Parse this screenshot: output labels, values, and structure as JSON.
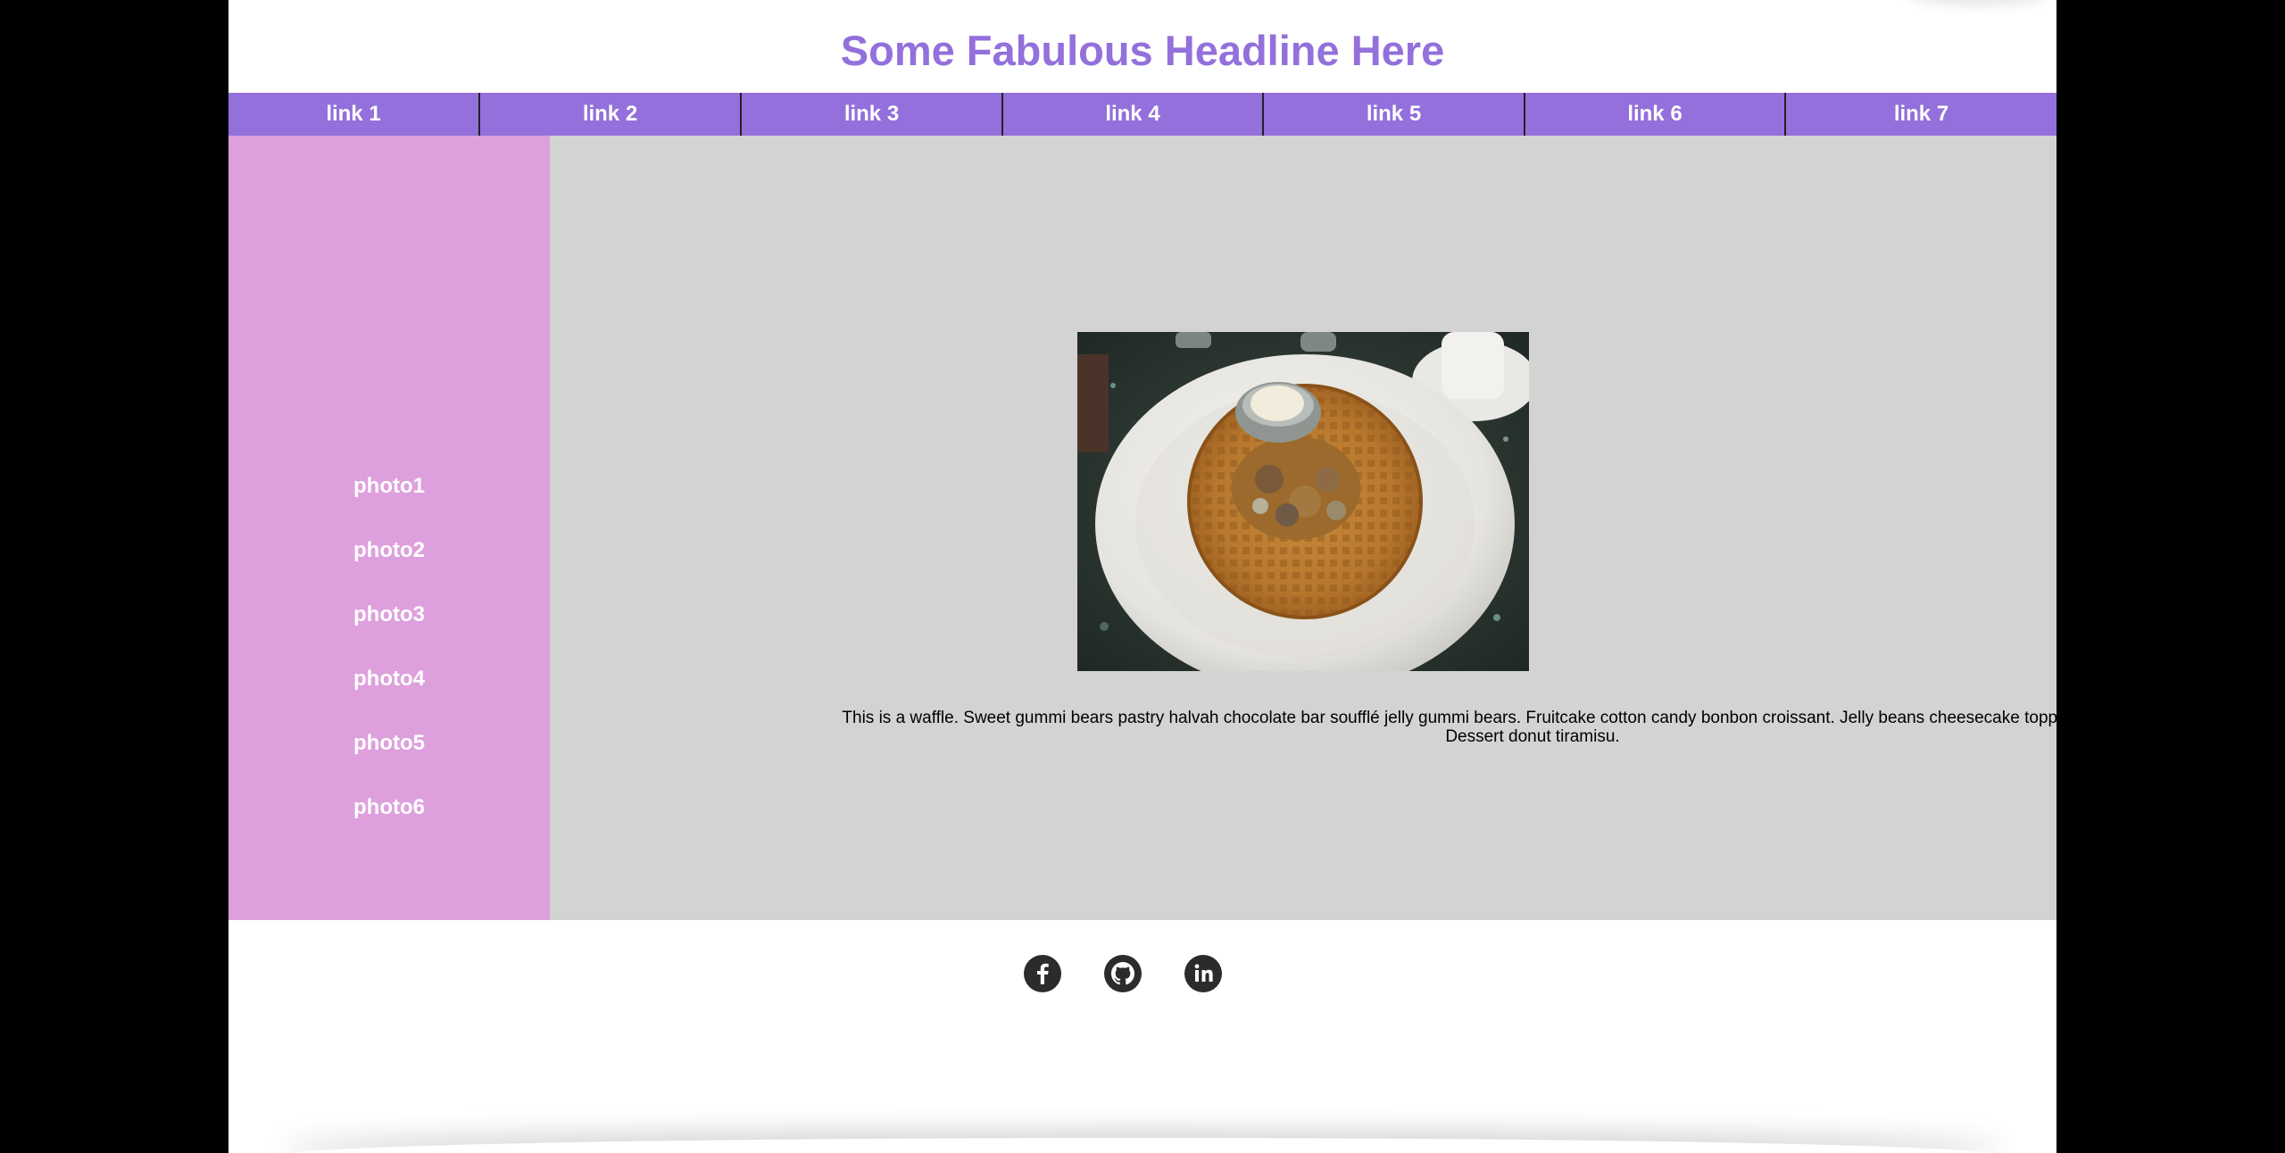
{
  "header": {
    "headline": "Some Fabulous Headline Here",
    "headline_color": "#9370db"
  },
  "nav": {
    "background": "#9370db",
    "links": [
      "link 1",
      "link 2",
      "link 3",
      "link 4",
      "link 5",
      "link 6",
      "link 7"
    ]
  },
  "sidebar": {
    "background": "#dda0dd",
    "items": [
      "photo1",
      "photo2",
      "photo3",
      "photo4",
      "photo5",
      "photo6"
    ]
  },
  "main": {
    "background": "#d3d3d3",
    "image_subject": "waffle on a white plate",
    "caption": "This is a waffle. Sweet gummi bears pastry halvah chocolate bar soufflé jelly gummi bears. Fruitcake cotton candy bonbon croissant. Jelly beans cheesecake topping. Jelly-o muffin tart. Dessert donut tiramisu."
  },
  "footer": {
    "icons": [
      "facebook-icon",
      "github-icon",
      "linkedin-icon"
    ]
  }
}
